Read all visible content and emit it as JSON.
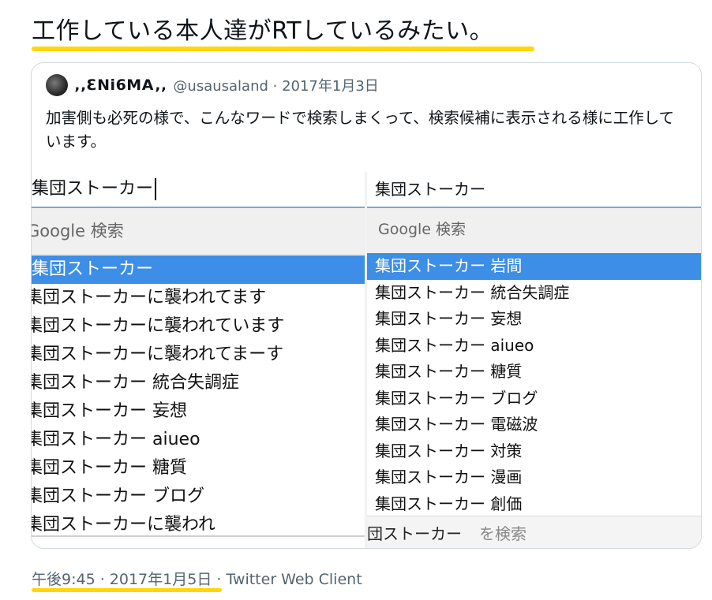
{
  "tweet": {
    "text": "工作している本人達がRTしているみたい。",
    "timestamp": "午後9:45 · 2017年1月5日",
    "client_sep": " · ",
    "client": "Twitter Web Client"
  },
  "quote": {
    "display_name": "‚‚ƐNi6MA‚‚",
    "handle_date": "@usausaland · 2017年1月3日",
    "body": "加害側も必死の様で、こんなワードで検索しまくって、検索候補に表示される様に工作しています。"
  },
  "left_panel": {
    "query": "集団ストーカー",
    "google_label": "Google 検索",
    "suggestions": [
      "集団ストーカー",
      "集団ストーカーに襲われてます",
      "集団ストーカーに襲われています",
      "集団ストーカーに襲われてまーす",
      "集団ストーカー 統合失調症",
      "集団ストーカー 妄想",
      "集団ストーカー aiueo",
      "集団ストーカー 糖質",
      "集団ストーカー ブログ",
      "集団ストーカーに襲われ"
    ]
  },
  "right_panel": {
    "query": "集団ストーカー",
    "google_label": "Google 検索",
    "suggestions": [
      "集団ストーカー 岩間",
      "集団ストーカー 統合失調症",
      "集団ストーカー 妄想",
      "集団ストーカー aiueo",
      "集団ストーカー 糖質",
      "集団ストーカー ブログ",
      "集団ストーカー 電磁波",
      "集団ストーカー 対策",
      "集団ストーカー 漫画",
      "集団ストーカー 創価"
    ],
    "footer_query": "団ストーカー",
    "footer_suffix": "を検索"
  },
  "colors": {
    "highlight_underline": "#ffd60a",
    "selected_suggestion": "#3c8ee6",
    "muted_text": "#536471"
  }
}
